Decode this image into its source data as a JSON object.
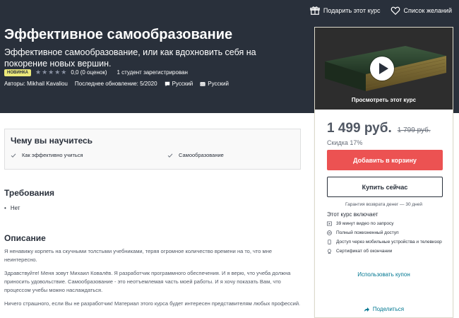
{
  "header": {
    "gift_label": "Подарить этот курс",
    "wishlist_label": "Список желаний",
    "title": "Эффективное самообразование",
    "subtitle": "Эффективное самообразование, или как вдохновить себя на покорение новых вершин.",
    "badge": "НОВИНКА",
    "rating_text": "0,0 (0 оценок)",
    "students": "1 студент зарегистрирован",
    "authors": "Авторы: Mikhail Kavaliou",
    "updated": "Последнее обновление: 5/2020",
    "language": "Русский",
    "captions": "Русский",
    "rating_value": 0
  },
  "sidebar": {
    "preview_label": "Просмотреть этот курс",
    "price": "1 499 руб.",
    "old_price": "1 799 руб.",
    "discount": "Скидка 17%",
    "add_to_cart": "Добавить в корзину",
    "buy_now": "Купить сейчас",
    "guarantee": "Гарантия возврата денег — 30 дней",
    "includes_title": "Этот курс включает",
    "includes": [
      {
        "icon": "video-icon",
        "text": "39 минут видео по запросу"
      },
      {
        "icon": "infinity-icon",
        "text": "Полный пожизненный доступ"
      },
      {
        "icon": "mobile-icon",
        "text": "Доступ через мобильные устройства и телевизор"
      },
      {
        "icon": "certificate-icon",
        "text": "Сертификат об окончании"
      }
    ],
    "coupon": "Использовать купон",
    "share": "Поделиться"
  },
  "learn": {
    "title": "Чему вы научитесь",
    "items": [
      "Как эффективно учиться",
      "Самообразование"
    ]
  },
  "requirements": {
    "title": "Требования",
    "items": [
      "Нет"
    ]
  },
  "description": {
    "title": "Описание",
    "paragraphs": [
      "Я ненавижу корпеть на скучными толстыми учебниками, теряя огромное количество времени на то, что мне неинтересно.",
      "Здравствуйте! Меня зовут Михаил Ковалёв. Я разработчик программного обеспечения. И я верю, что учеба должна приносить удовольствие. Самообразование - это неотъемлемая часть моей работы. И я хочу показать Вам, что процессом учебы можно наслаждаться.",
      "Ничего страшного, если Вы не разработчик! Материал этого курса будет интересен представителям любых профессий."
    ]
  },
  "colors": {
    "header_bg": "#29303b",
    "cart_button": "#ec5252",
    "link": "#007791",
    "badge": "#ece97a"
  }
}
